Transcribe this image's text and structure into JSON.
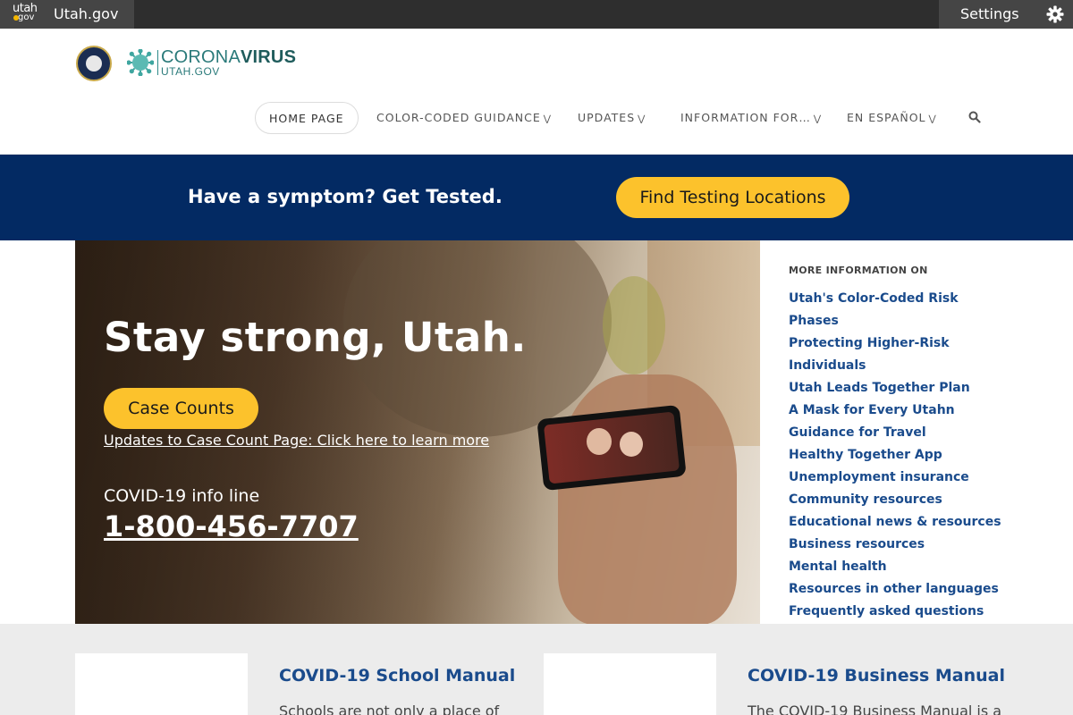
{
  "topbar": {
    "logo_top": "utah",
    "logo_bottom": "gov",
    "site_name": "Utah.gov",
    "settings_label": "Settings"
  },
  "header": {
    "logo_main_light": "CORONA",
    "logo_main_bold": "VIRUS",
    "logo_sub": "UTAH.GOV",
    "nav": [
      {
        "label": "HOME PAGE",
        "dropdown": false
      },
      {
        "label": "COLOR-CODED GUIDANCE",
        "dropdown": true
      },
      {
        "label": "UPDATES",
        "dropdown": true
      },
      {
        "label": "INFORMATION FOR…",
        "dropdown": true
      },
      {
        "label": "EN ESPAÑOL",
        "dropdown": true
      }
    ]
  },
  "banner": {
    "text": "Have a symptom? Get Tested.",
    "button": "Find Testing Locations"
  },
  "hero": {
    "title": "Stay strong, Utah.",
    "case_button": "Case Counts",
    "case_link": "Updates to Case Count Page: Click here to learn more",
    "info_label": "COVID-19 info line",
    "phone": "1-800-456-7707"
  },
  "sidebar": {
    "heading": "MORE INFORMATION ON",
    "links": [
      "Utah's Color-Coded Risk Phases",
      "Protecting Higher-Risk",
      "Individuals",
      "Utah Leads Together Plan",
      "A Mask for Every Utahn",
      "Guidance for Travel",
      "Healthy Together App",
      "Unemployment insurance",
      "Community resources",
      "Educational news & resources",
      "Business resources",
      "Mental health",
      "Resources in other languages",
      "Frequently asked questions"
    ]
  },
  "cards": [
    {
      "title": "COVID-19 School Manual",
      "text": "Schools are not only a place of"
    },
    {
      "title": "COVID-19 Business Manual",
      "text": "The COVID-19 Business Manual is a"
    }
  ],
  "colors": {
    "banner_bg": "#032a63",
    "accent_yellow": "#fcc22c",
    "link_blue": "#1a4b8c"
  }
}
